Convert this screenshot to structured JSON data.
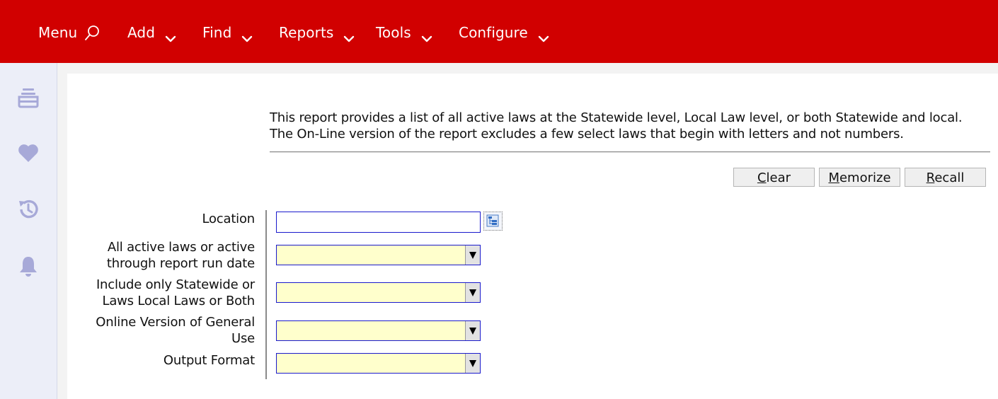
{
  "nav": {
    "menu_label": "Menu",
    "items": [
      {
        "label": "Add"
      },
      {
        "label": "Find"
      },
      {
        "label": "Reports"
      },
      {
        "label": "Tools"
      },
      {
        "label": "Configure"
      }
    ]
  },
  "sidebar": {
    "icons": [
      "inbox-icon",
      "heart-icon",
      "history-icon",
      "bell-icon"
    ]
  },
  "report": {
    "description_line1": "This report provides a list of all active laws at the Statewide level, Local Law level, or both Statewide and local.",
    "description_line2": "The On-Line version of the report excludes a few select laws that begin with letters and not numbers."
  },
  "buttons": {
    "clear_rest": "lear",
    "clear_key": "C",
    "memorize_key": "M",
    "memorize_rest": "emorize",
    "recall_key": "R",
    "recall_rest": "ecall"
  },
  "form": {
    "location": {
      "label": "Location",
      "value": ""
    },
    "active_laws": {
      "label_line1": "All active laws or active",
      "label_line2": "through report run date",
      "value": ""
    },
    "statewide_local": {
      "label_line1": "Include only Statewide or",
      "label_line2": "Laws Local Laws or Both",
      "value": ""
    },
    "online_version": {
      "label_line1": "Online Version of General",
      "label_line2": "Use",
      "value": ""
    },
    "output_format": {
      "label": "Output Format",
      "value": ""
    }
  },
  "colors": {
    "brand_red": "#d10000",
    "sidebar_bg": "#eceef8",
    "sidebar_icon": "#a7a9d8",
    "input_border": "#1a1acc",
    "select_bg": "#ffffcc"
  }
}
